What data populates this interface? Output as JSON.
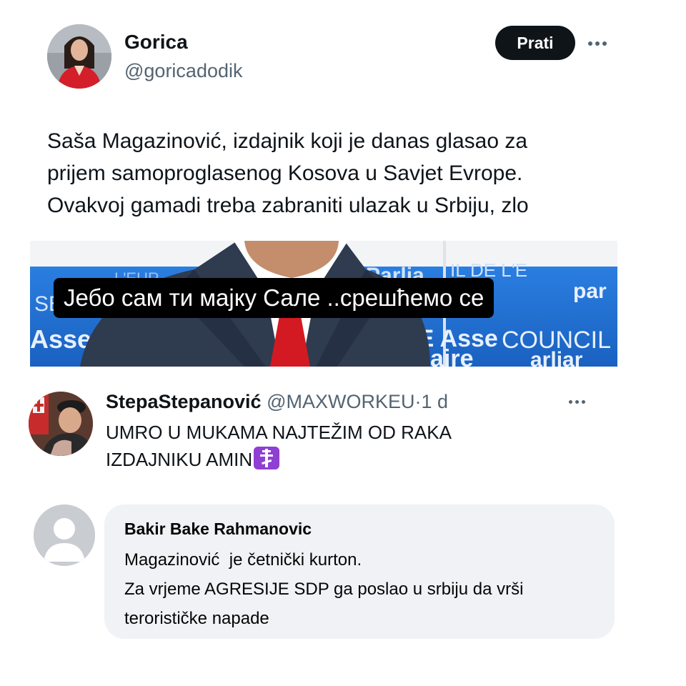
{
  "tweet": {
    "author_name": "Gorica",
    "author_handle": "@goricadodik",
    "follow_label": "Prati",
    "text_lines": [
      "Saša Magazinović, izdajnik koji je danas glasao za",
      "prijem samoproglasenog Kosova u Savjet Evrope.",
      "Ovakvoj gamadi treba zabraniti ulazak u Srbiju, zlo"
    ],
    "media": {
      "caption": "Јебо сам ти мајку Сале ..срешћемо се",
      "background_text": [
        "Parliam",
        "CONSEIL DE L'EUROPE",
        "Assemb",
        "COUNCIL",
        "aire",
        "parliar",
        "PE Assem"
      ]
    }
  },
  "reply": {
    "name": "StepaStepanović",
    "handle": "@MAXWORKEU",
    "separator": "·",
    "time": "1 d",
    "text_lines": [
      "UMRO U MUKAMA NAJTEŽIM OD RAKA",
      "IZDAJNIKU AMIN"
    ],
    "emoji": "orthodox-cross-icon"
  },
  "comment": {
    "name": "Bakir Bake Rahmanovic",
    "text_lines": [
      "Magazinović  je četnički kurton.",
      "Za vrjeme AGRESIJE SDP ga poslao u srbiju da vrši",
      "terorističke napade"
    ]
  },
  "colors": {
    "text_primary": "#0f1419",
    "text_secondary": "#536471",
    "follow_bg": "#0f1419",
    "bubble_bg": "#f0f2f5",
    "council_blue": "#1f6fd1",
    "emoji_purple": "#8f3fd4"
  }
}
